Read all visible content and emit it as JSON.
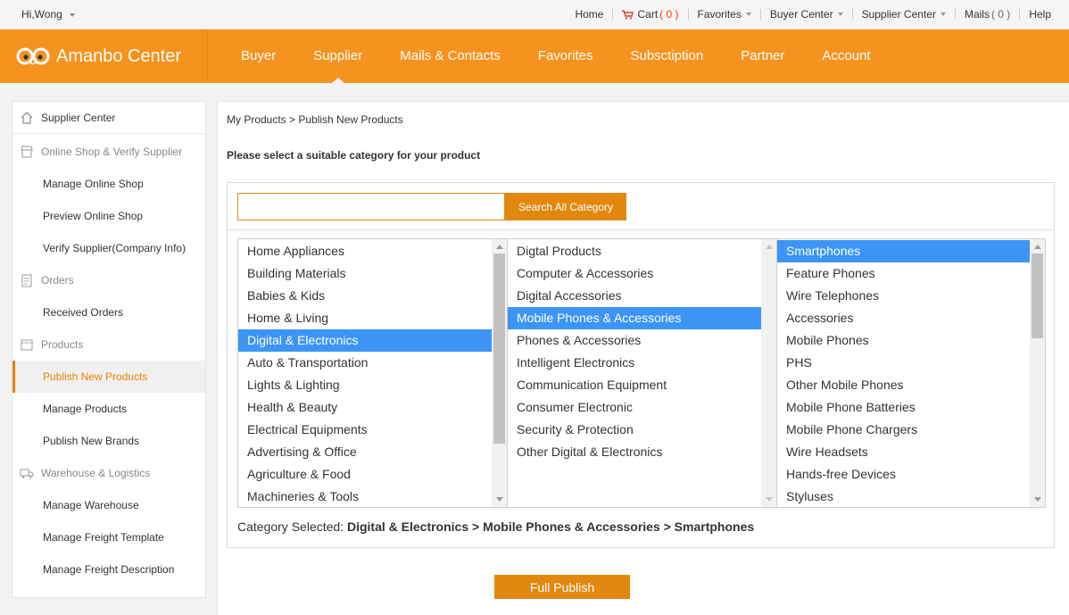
{
  "topbar": {
    "greeting": "Hi,Wong",
    "links": {
      "home": "Home",
      "cart": "Cart",
      "cart_count": "( 0 )",
      "favorites": "Favorites",
      "buyer_center": "Buyer Center",
      "supplier_center": "Supplier Center",
      "mails": "Mails",
      "mails_count": "( 0 )",
      "help": "Help"
    }
  },
  "header": {
    "brand": "Amanbo Center",
    "nav": [
      "Buyer",
      "Supplier",
      "Mails & Contacts",
      "Favorites",
      "Subsctiption",
      "Partner",
      "Account"
    ],
    "active_nav": "Supplier"
  },
  "sidebar": {
    "home": "Supplier Center",
    "sections": [
      {
        "title": "Online Shop & Verify Supplier",
        "items": [
          "Manage Online Shop",
          "Preview Online Shop",
          "Verify Supplier(Company Info)"
        ]
      },
      {
        "title": "Orders",
        "items": [
          "Received Orders"
        ]
      },
      {
        "title": "Products",
        "items": [
          "Publish New Products",
          "Manage Products",
          "Publish New Brands"
        ]
      },
      {
        "title": "Warehouse & Logistics",
        "items": [
          "Manage Warehouse",
          "Manage Freight Template",
          "Manage Freight Description"
        ]
      }
    ],
    "active_item": "Publish New Products"
  },
  "main": {
    "breadcrumb": "My Products > Publish New Products",
    "prompt": "Please select a suitable category for your product",
    "search": {
      "value": "",
      "placeholder": "",
      "button": "Search All Category"
    },
    "columns": [
      {
        "options": [
          "Home Appliances",
          "Building Materials",
          "Babies & Kids",
          "Home & Living",
          "Digital & Electronics",
          "Auto & Transportation",
          "Lights & Lighting",
          "Health & Beauty",
          "Electrical Equipments",
          "Advertising & Office",
          "Agriculture & Food",
          "Machineries & Tools"
        ],
        "selected": "Digital & Electronics"
      },
      {
        "options": [
          "Digtal Products",
          "Computer & Accessories",
          "Digital Accessories",
          "Mobile Phones & Accessories",
          "Phones & Accessories",
          "Intelligent Electronics",
          "Communication Equipment",
          "Consumer Electronic",
          "Security & Protection",
          "Other Digital & Electronics"
        ],
        "selected": "Mobile Phones & Accessories"
      },
      {
        "options": [
          "Smartphones",
          "Feature Phones",
          "Wire Telephones",
          "Accessories",
          "Mobile Phones",
          "PHS",
          "Other Mobile Phones",
          "Mobile Phone Batteries",
          "Mobile Phone Chargers",
          "Wire Headsets",
          "Hands-free Devices",
          "Styluses"
        ],
        "selected": "Smartphones"
      }
    ],
    "category_selected_label": "Category Selected:",
    "category_selected_value": "Digital & Electronics > Mobile Phones & Accessories > Smartphones",
    "publish_button": "Full Publish"
  },
  "colors": {
    "brand_orange": "#f6921e",
    "button_orange": "#e2880f",
    "selection_blue": "#3c95f5",
    "active_sidebar": "#f08200"
  }
}
